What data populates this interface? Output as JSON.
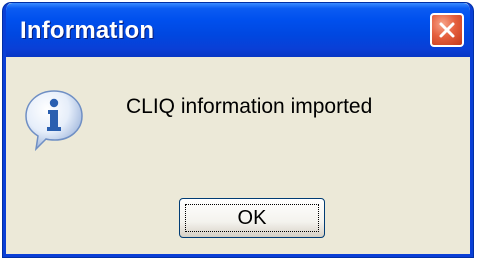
{
  "dialog": {
    "title": "Information",
    "message": "CLIQ information imported",
    "ok_label": "OK",
    "icon": "information-icon",
    "close_icon": "close-icon"
  },
  "colors": {
    "title_bar": "#0050ee",
    "client_background": "#ece9d8",
    "close_button": "#e5603e",
    "info_icon_blue": "#2a5fb0"
  }
}
